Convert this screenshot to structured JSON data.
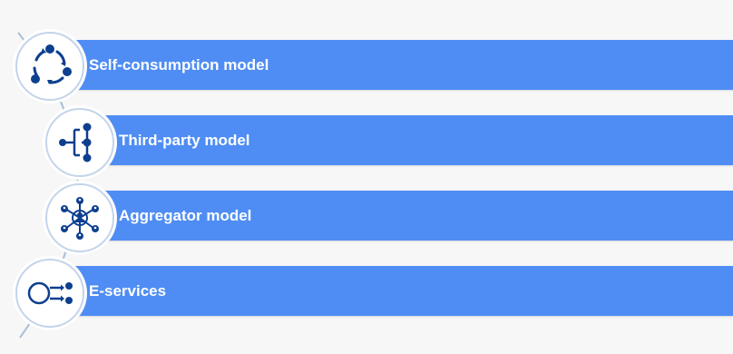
{
  "items": [
    {
      "label": "Self-consumption model",
      "icon": "cycle-icon"
    },
    {
      "label": "Third-party model",
      "icon": "hierarchy-icon"
    },
    {
      "label": "Aggregator model",
      "icon": "network-icon"
    },
    {
      "label": "E-services",
      "icon": "services-icon"
    }
  ],
  "colors": {
    "band": "#4f8df4",
    "icon": "#0d3f8f",
    "text": "#ffffff"
  }
}
